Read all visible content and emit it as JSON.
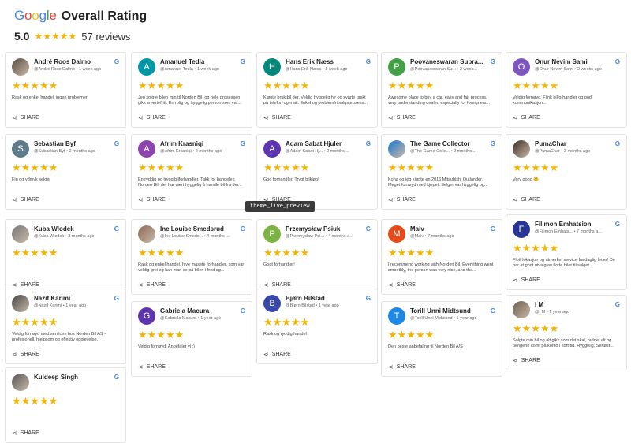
{
  "header": {
    "brand": "Google",
    "title": "Overall Rating",
    "score": "5.0",
    "stars": "★★★★★",
    "review_count": "57 reviews"
  },
  "tooltip": "theme_live_preview",
  "share_label": "SHARE",
  "stars": "★★★★★",
  "google_glyph": "G",
  "columns": [
    [
      {
        "name": "André Roos Dalmo",
        "meta": "@André Roos Dalmo  •  1 week ago",
        "avatar": "",
        "avatar_color": "#5b4b40",
        "photo": true,
        "text": "Rask og enkel handel, ingen problemer"
      },
      {
        "name": "Sebastian Byf",
        "meta": "@Sebastian Byf  •  2 months ago",
        "avatar": "S",
        "avatar_color": "#5f7c8a",
        "photo": false,
        "text": "Fin og ydmyk selger"
      },
      {
        "name": "Kuba Wlodek",
        "meta": "@Kuba Wlodek  •  3 months ago",
        "avatar": "",
        "avatar_color": "#777",
        "photo": true,
        "text": ""
      },
      {
        "name": "Nazif Karimi",
        "meta": "@Nazif Karimi  •  1 year ago",
        "avatar": "",
        "avatar_color": "#444",
        "photo": true,
        "text": "Veldig fornøyd med servicen hos Norden Bil AS – profesjonell, hjelpsom og effektiv opplevelse."
      },
      {
        "name": "Kuldeep Singh",
        "meta": "",
        "avatar": "",
        "avatar_color": "#555",
        "photo": true,
        "text": ""
      }
    ],
    [
      {
        "name": "Amanuel Tedla",
        "meta": "@Amanuel Tedla  •  1 week ago",
        "avatar": "A",
        "avatar_color": "#0097a7",
        "photo": false,
        "text": "Jeg solgte bilen min til Norden Bil, og hele prosessen gikk smertefritt. En rolig og hyggelig person som var..."
      },
      {
        "name": "Afrim Krasniqi",
        "meta": "@Afrim Krasniqi  •  2 months ago",
        "avatar": "A",
        "avatar_color": "#8e44ad",
        "photo": false,
        "text": "En ryddig og trygg bilforhandler. Takk for handelen Norden Bil, det har vært hyggelig å handle bil fra der..."
      },
      {
        "name": "Ine Louise Smedsrud",
        "meta": "@Ine Louise Smeds...  •  4 months ...",
        "avatar": "",
        "avatar_color": "#8a6a55",
        "photo": true,
        "text": "Rask og enkel handel, hive masete forhandler, som var veldig grei og kan man se på bilen i fred og..."
      },
      {
        "name": "Gabriela Macura",
        "meta": "@Gabriela Macura  •  1 year ago",
        "avatar": "G",
        "avatar_color": "#5e35b1",
        "photo": false,
        "text": "Veldig fornøyd! Anbefaler vi :)"
      }
    ],
    [
      {
        "name": "Hans Erik Næss",
        "meta": "@Hans Erik Næss  •  1 week ago",
        "avatar": "H",
        "avatar_color": "#00897b",
        "photo": false,
        "text": "Kjøpte bruktbil der. Veldig hyggelig fyr og svarte raskt på telefon og mail. Enkel og problemfri salgsprosess..."
      },
      {
        "name": "Adam Sabat Hjuler",
        "meta": "@Adam Sabat Hj...  •  2 months ...",
        "avatar": "A",
        "avatar_color": "#5e35b1",
        "photo": false,
        "text": "God forhandler. Trygt bilkjøp!"
      },
      {
        "name": "Przemysław Psiuk",
        "meta": "@Przemysław Psi...  •  4 months a...",
        "avatar": "P",
        "avatar_color": "#7cb342",
        "photo": false,
        "text": "Godt forhandler!"
      },
      {
        "name": "Bjørn Bilstad",
        "meta": "@Bjørn Bilstad  •  1 year ago",
        "avatar": "B",
        "avatar_color": "#3949ab",
        "photo": false,
        "text": "Rask og ryddig handel"
      }
    ],
    [
      {
        "name": "Poovaneswaran Supra...",
        "meta": "@Poovaneswaran Su...  •  2 week...",
        "avatar": "P",
        "avatar_color": "#43a047",
        "photo": false,
        "text": "Awesome place to buy a car, easy and fair process, very understanding dealer, especially for foreigners..."
      },
      {
        "name": "The Game Collector",
        "meta": "@The Game Colle...  •  2 months ...",
        "avatar": "",
        "avatar_color": "#1976d2",
        "photo": true,
        "text": "Kona og jeg kjøpte en 2016 Mitsubishi Outlander. Meget fornøyd med kjøpet. Selger var hyggelig og..."
      },
      {
        "name": "Malv",
        "meta": "@Malv  •  7 months ago",
        "avatar": "M",
        "avatar_color": "#e64a19",
        "photo": false,
        "text": "I recommend working with Norden Bil. Everything went smoothly, the person was very nice, and the..."
      },
      {
        "name": "Torill Unni Midtsund",
        "meta": "@Torill Unni Midtsund  •  1 year ago",
        "avatar": "T",
        "avatar_color": "#1e88e5",
        "photo": false,
        "text": "Den beste anbefaling til Norden Bil A/S"
      }
    ],
    [
      {
        "name": "Onur Nevim Sami",
        "meta": "@Onur Nevim Sami  •  2 weeks ago",
        "avatar": "O",
        "avatar_color": "#7e57c2",
        "photo": false,
        "text": "Veldig fornøyd. Flink bilforhandler og god kommunikasjon..."
      },
      {
        "name": "PumaChar",
        "meta": "@PumaChar  •  3 months ago",
        "avatar": "",
        "avatar_color": "#3e2c23",
        "photo": true,
        "text": "Very good 😊"
      },
      {
        "name": "Filimon Emhatsion",
        "meta": "@Filimon Emhats...  •  7 months a...",
        "avatar": "F",
        "avatar_color": "#283593",
        "photo": false,
        "text": "Flott lokasjon og utmerket service fra daglig leder! De har et godt utvalg av flotte biler til salget..."
      },
      {
        "name": "I M",
        "meta": "@I M  •  1 year ago",
        "avatar": "",
        "avatar_color": "#6d5c4d",
        "photo": true,
        "text": "Solgte min bil og alt gikk som det skal, ordnet alt og pengene komt på konto i kort tid. Hyggelig, Seriøst..."
      }
    ]
  ]
}
